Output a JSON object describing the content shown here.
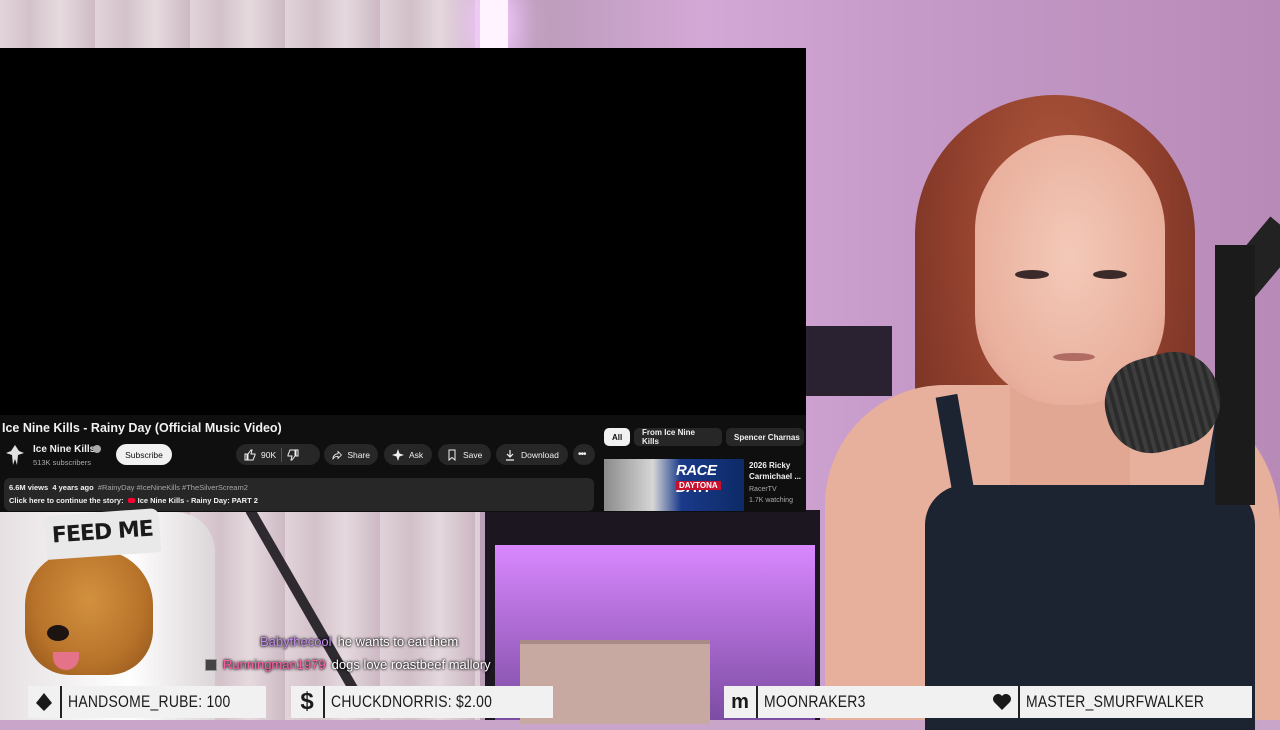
{
  "youtube": {
    "video_title": "Ice Nine Kills - Rainy Day (Official Music Video)",
    "channel_name": "Ice Nine Kills",
    "channel_subs": "513K subscribers",
    "subscribe_label": "Subscribe",
    "like_count": "90K",
    "share_label": "Share",
    "ask_label": "Ask",
    "save_label": "Save",
    "download_label": "Download",
    "views": "6.6M views",
    "age": "4 years ago",
    "tags": "#RainyDay #IceNineKills #TheSilverScream2",
    "story_prefix": "Click here to continue the story:",
    "story_link": "Ice Nine Kills - Rainy Day: PART 2",
    "chips": [
      "All",
      "From Ice Nine Kills",
      "Spencer Charnas"
    ],
    "rec_thumb_title": "RACE DAY!",
    "rec_thumb_sub": "DAYTONA",
    "rec_title": "2026 Ricky Carmichael ...",
    "rec_channel": "RacerTV",
    "rec_watching": "1.7K watching"
  },
  "dog_hat_text": "FEED ME",
  "chat": [
    {
      "user": "Babythecool",
      "message": "he wants to eat them",
      "color": "#c48bf0"
    },
    {
      "user": "Runningman1979",
      "message": "dogs love roastbeef mallory",
      "color": "#ff5fa8"
    }
  ],
  "alerts": [
    {
      "icon": "triangle-icon",
      "text": "HANDSOME_RUBE: 100"
    },
    {
      "icon": "dollar-icon",
      "text": "CHUCKDNORRIS: $2.00"
    },
    {
      "icon": "m-logo-icon",
      "text": "MOONRAKER3"
    },
    {
      "icon": "heart-icon",
      "text": "MASTER_SMURFWALKER"
    }
  ]
}
